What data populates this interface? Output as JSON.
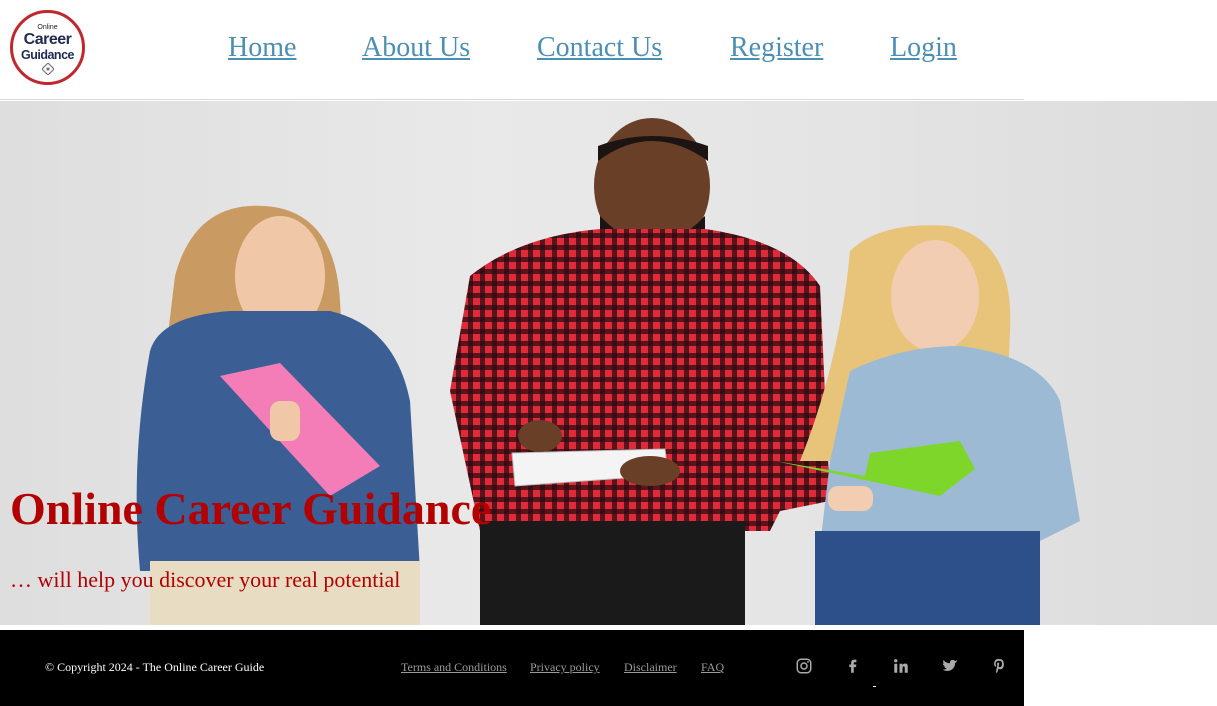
{
  "logo": {
    "line1": "Online",
    "line2": "Career",
    "line3": "Guidance"
  },
  "nav": {
    "home": "Home",
    "about": "About Us",
    "contact": "Contact Us",
    "register": "Register",
    "login": "Login"
  },
  "hero": {
    "title": "Online Career Guidance",
    "subtitle": "… will help you discover your real potential"
  },
  "footer": {
    "copyright": "© Copyright 2024 - The Online Career Guide",
    "links": {
      "terms": "Terms and Conditions",
      "privacy": "Privacy policy",
      "disclaimer": "Disclaimer",
      "faq": "FAQ"
    },
    "social": [
      "instagram-icon",
      "facebook-icon",
      "linkedin-icon",
      "twitter-icon",
      "pinterest-icon"
    ]
  },
  "colors": {
    "nav_link": "#4b8fb5",
    "hero_text": "#b30000",
    "footer_bg": "#000000",
    "footer_link": "#9a9a9a",
    "logo_ring": "#c0282d"
  }
}
